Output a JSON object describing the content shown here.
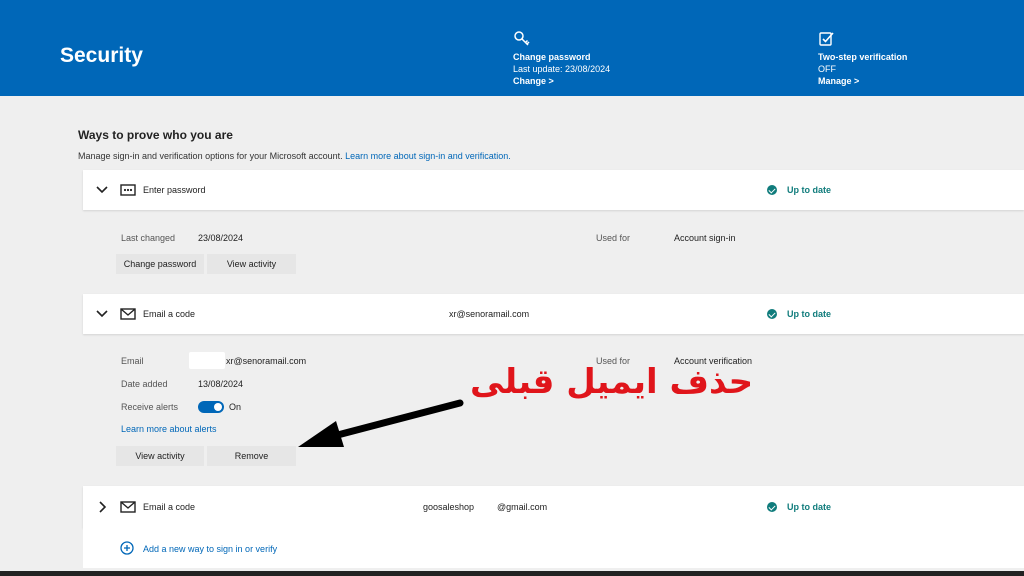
{
  "header": {
    "title": "Security",
    "password": {
      "title": "Change password",
      "subtitle": "Last update: 23/08/2024",
      "link": "Change >",
      "icon": "key-icon"
    },
    "two_step": {
      "title": "Two-step verification",
      "subtitle": "OFF",
      "link": "Manage >",
      "icon": "shield-check-icon"
    }
  },
  "section": {
    "title": "Ways to prove who you are",
    "subtitle": "Manage sign-in and verification options for your Microsoft account.",
    "learn_more": "Learn more about sign-in and verification."
  },
  "methods": [
    {
      "label": "Enter password",
      "status": "Up to date",
      "details": {
        "last_changed_label": "Last changed",
        "last_changed_value": "23/08/2024",
        "used_for_label": "Used for",
        "used_for_value": "Account sign-in",
        "btn_change": "Change password",
        "btn_activity": "View activity"
      }
    },
    {
      "label": "Email a code",
      "value": "xr@senoramail.com",
      "status": "Up to date",
      "details": {
        "email_label": "Email",
        "email_value": "xr@senoramail.com",
        "date_added_label": "Date added",
        "date_added_value": "13/08/2024",
        "receive_alerts_label": "Receive alerts",
        "receive_alerts_value": "On",
        "used_for_label": "Used for",
        "used_for_value": "Account verification",
        "learn_alerts": "Learn more about alerts",
        "btn_activity": "View activity",
        "btn_remove": "Remove"
      }
    },
    {
      "label": "Email a code",
      "value_user": "goosaleshop",
      "value_domain": "@gmail.com",
      "status": "Up to date"
    }
  ],
  "add_method": "Add a new way to sign in or verify",
  "annotation": "حذف ایمیل قبلی",
  "colors": {
    "brand": "#0067b8",
    "status": "#107c7c",
    "annotation": "#e0151b"
  }
}
